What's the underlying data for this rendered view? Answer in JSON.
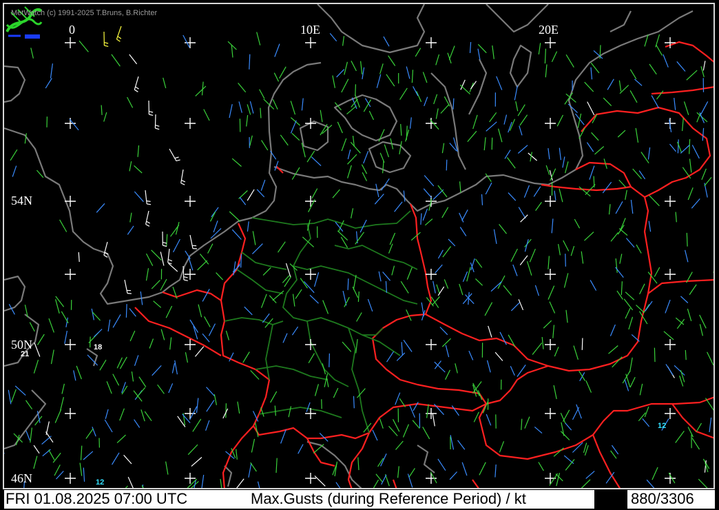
{
  "copyright": "MetWatch  (c) 1991-2025 T.Bruns, B.Richter",
  "lon_labels": [
    "0",
    "10E",
    "20E"
  ],
  "lat_labels": [
    "54N",
    "50N",
    "46N"
  ],
  "station_values": [
    {
      "value": "18",
      "color": "#ffffff"
    },
    {
      "value": "21",
      "color": "#ffffff"
    },
    {
      "value": "12",
      "color": "#33e0ff"
    },
    {
      "value": "12",
      "color": "#33e0ff"
    }
  ],
  "status": {
    "datetime": "FRI 01.08.2025 07:00 UTC",
    "product": "Max.Gusts (during Reference Period) / kt",
    "counter": "880/3306"
  },
  "colors": {
    "coastline": "#7a7a7a",
    "country_border": "#ff2020",
    "state_border": "#1e7a1e",
    "grid_cross": "#ffffff",
    "barb_green": "#3ad23a",
    "barb_blue": "#3a8cff",
    "barb_white": "#ffffff",
    "barb_yellow": "#ffff40"
  }
}
